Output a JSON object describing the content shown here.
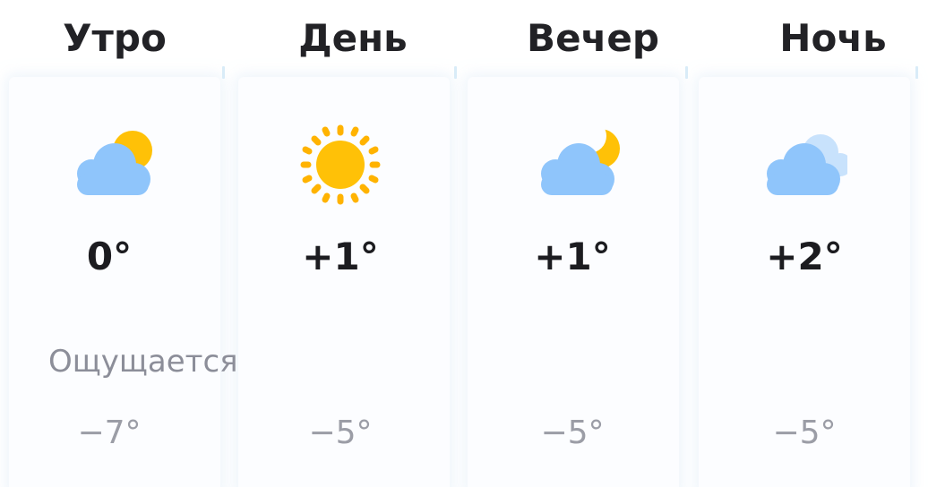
{
  "feels_like_label": "Ощущается",
  "periods": [
    {
      "name": "Утро",
      "icon": "cloud-sun-icon",
      "temp": "0°",
      "feels_like": "−7°"
    },
    {
      "name": "День",
      "icon": "sun-icon",
      "temp": "+1°",
      "feels_like": "−5°"
    },
    {
      "name": "Вечер",
      "icon": "cloud-moon-icon",
      "temp": "+1°",
      "feels_like": "−5°"
    },
    {
      "name": "Ночь",
      "icon": "cloudy-icon",
      "temp": "+2°",
      "feels_like": "−5°"
    }
  ],
  "colors": {
    "cloud": "#8fc5fb",
    "cloud_back": "#c8e2fc",
    "sun": "#ffc107",
    "sun_ray": "#ffb300",
    "moon": "#ffc107"
  }
}
